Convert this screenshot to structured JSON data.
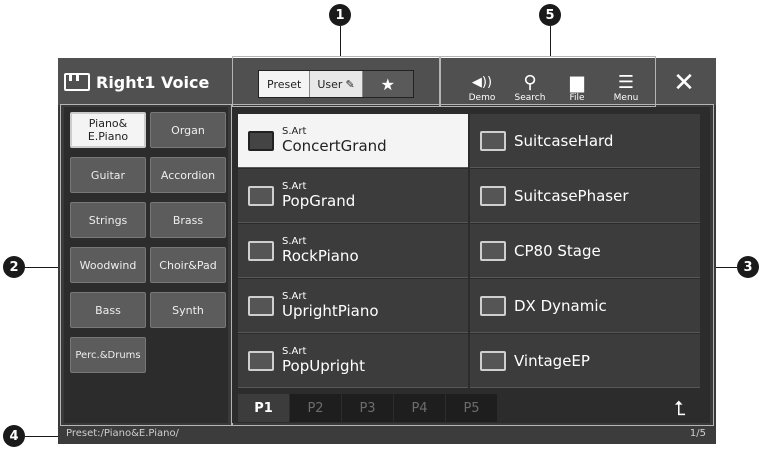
{
  "callouts": [
    "1",
    "2",
    "3",
    "4",
    "5"
  ],
  "header": {
    "title": "Right1 Voice",
    "tabs": {
      "preset": "Preset",
      "user": "User",
      "favorite": "★"
    },
    "tools": [
      {
        "label": "Demo",
        "icon": "speaker-icon",
        "glyph": "◀))"
      },
      {
        "label": "Search",
        "icon": "search-icon",
        "glyph": "⚲"
      },
      {
        "label": "File",
        "icon": "folder-icon",
        "glyph": "▆"
      },
      {
        "label": "Menu",
        "icon": "menu-icon",
        "glyph": "☰"
      }
    ],
    "close": "✕"
  },
  "categories": [
    {
      "label": "Piano&\nE.Piano",
      "active": true
    },
    {
      "label": "Organ"
    },
    {
      "label": "Guitar"
    },
    {
      "label": "Accordion"
    },
    {
      "label": "Strings"
    },
    {
      "label": "Brass"
    },
    {
      "label": "Woodwind"
    },
    {
      "label": "Choir&Pad"
    },
    {
      "label": "Bass"
    },
    {
      "label": "Synth"
    },
    {
      "label": "Perc.&Drums"
    }
  ],
  "voices": [
    {
      "sart": "S.Art",
      "name": "ConcertGrand",
      "icon": "grand-piano-icon",
      "selected": true
    },
    {
      "sart": "",
      "name": "SuitcaseHard",
      "icon": "electric-piano-icon"
    },
    {
      "sart": "S.Art",
      "name": "PopGrand",
      "icon": "grand-piano-icon"
    },
    {
      "sart": "",
      "name": "SuitcasePhaser",
      "icon": "electric-piano-icon"
    },
    {
      "sart": "S.Art",
      "name": "RockPiano",
      "icon": "grand-piano-icon"
    },
    {
      "sart": "",
      "name": "CP80 Stage",
      "icon": "stage-piano-icon"
    },
    {
      "sart": "S.Art",
      "name": "UprightPiano",
      "icon": "upright-piano-icon"
    },
    {
      "sart": "",
      "name": "DX Dynamic",
      "icon": "synth-keyboard-icon"
    },
    {
      "sart": "S.Art",
      "name": "PopUpright",
      "icon": "upright-piano-icon"
    },
    {
      "sart": "",
      "name": "VintageEP",
      "icon": "electric-piano-icon"
    }
  ],
  "pages": [
    "P1",
    "P2",
    "P3",
    "P4",
    "P5"
  ],
  "up_glyph": "⮤",
  "status": {
    "path": "Preset:/Piano&E.Piano/",
    "page": "1/5"
  },
  "colors": {
    "screen": "#3a3a3a",
    "header": "#505050",
    "selected": "#f4f4f4"
  }
}
